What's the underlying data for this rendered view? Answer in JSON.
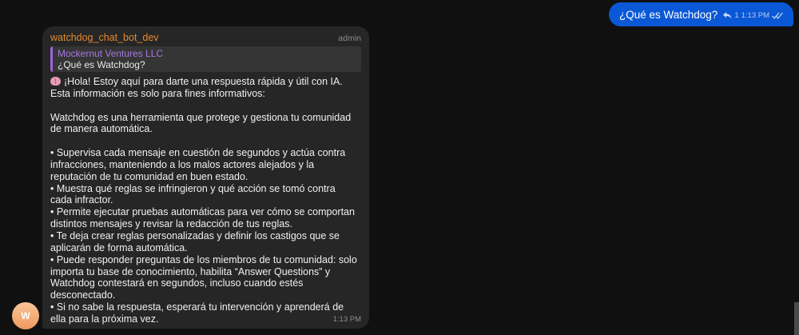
{
  "outgoing": {
    "text": "¿Qué es Watchdog?",
    "replies": "1",
    "time": "1:13 PM"
  },
  "incoming": {
    "sender": "watchdog_chat_bot_dev",
    "role": "admin",
    "reply_to": {
      "author": "Mockernut Ventures LLC",
      "text": "¿Qué es Watchdog?"
    },
    "lines": [
      "¡Hola! Estoy aquí para darte una respuesta rápida y útil con IA.",
      "Esta información es solo para fines informativos:",
      "",
      "Watchdog es una herramienta que protege y gestiona tu comunidad",
      "de manera automática.",
      "",
      "• Supervisa cada mensaje en cuestión de segundos y actúa contra",
      "infracciones, manteniendo a los malos actores alejados y la",
      "reputación de tu comunidad en buen estado.",
      "• Muestra qué reglas se infringieron y qué acción se tomó contra",
      "cada infractor.",
      "• Permite ejecutar pruebas automáticas para ver cómo se comportan",
      "distintos mensajes y revisar la redacción de tus reglas.",
      "• Te deja crear reglas personalizadas y definir los castigos que se",
      "aplicarán de forma automática.",
      "• Puede responder preguntas de los miembros de tu comunidad: solo",
      "importa tu base de conocimiento, habilita “Answer Questions” y",
      "Watchdog contestará en segundos, incluso cuando estés",
      "desconectado.",
      "• Si no sabe la respuesta, esperará tu intervención y aprenderá de",
      "ella para la próxima vez."
    ],
    "time": "1:13 PM",
    "avatar_initial": "W"
  },
  "icons": {
    "reply": "reply-arrow-icon",
    "read": "double-check-icon",
    "brain": "brain-emoji-icon"
  },
  "colors": {
    "background": "#101010",
    "outgoing_bubble": "#0a58d6",
    "incoming_bubble": "#262626",
    "sender": "#e5892e",
    "reply_bar": "#9a66d8"
  }
}
